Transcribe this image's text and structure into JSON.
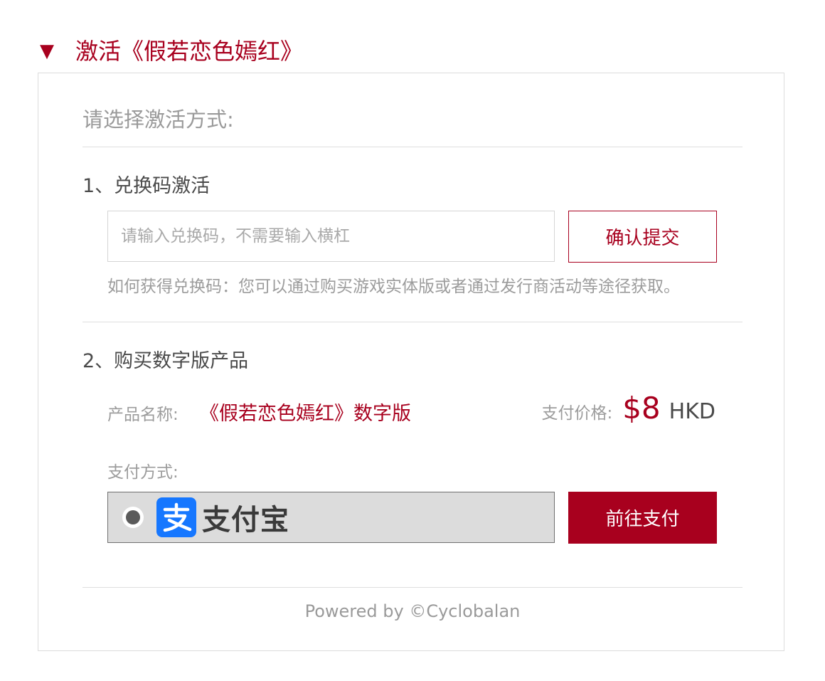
{
  "colors": {
    "accent": "#a8001e",
    "muted_text": "#9c9c9c",
    "body_text": "#4a4a4a",
    "border": "#dcdcdc",
    "alipay_blue": "#1677ff"
  },
  "header": {
    "marker_icon": "triangle-down-icon",
    "marker_glyph": "▼",
    "title": "激活《假若恋色嫣红》"
  },
  "panel": {
    "prompt": "请选择激活方式:"
  },
  "redeem": {
    "title": "1、兑换码激活",
    "input_value": "",
    "input_placeholder": "请输入兑换码，不需要输入横杠",
    "confirm_label": "确认提交",
    "hint": "如何获得兑换码：您可以通过购买游戏实体版或者通过发行商活动等途径获取。"
  },
  "purchase": {
    "title": "2、购买数字版产品",
    "product_label": "产品名称:",
    "product_name": "《假若恋色嫣红》数字版",
    "price_label": "支付价格:",
    "price_amount": "$8",
    "price_currency": "HKD",
    "payment_label": "支付方式:",
    "payment_option": {
      "selected": true,
      "icon": "alipay-logo-icon",
      "name": "支付宝"
    },
    "pay_button_label": "前往支付"
  },
  "footer": {
    "text": "Powered by ©Cyclobalan"
  }
}
